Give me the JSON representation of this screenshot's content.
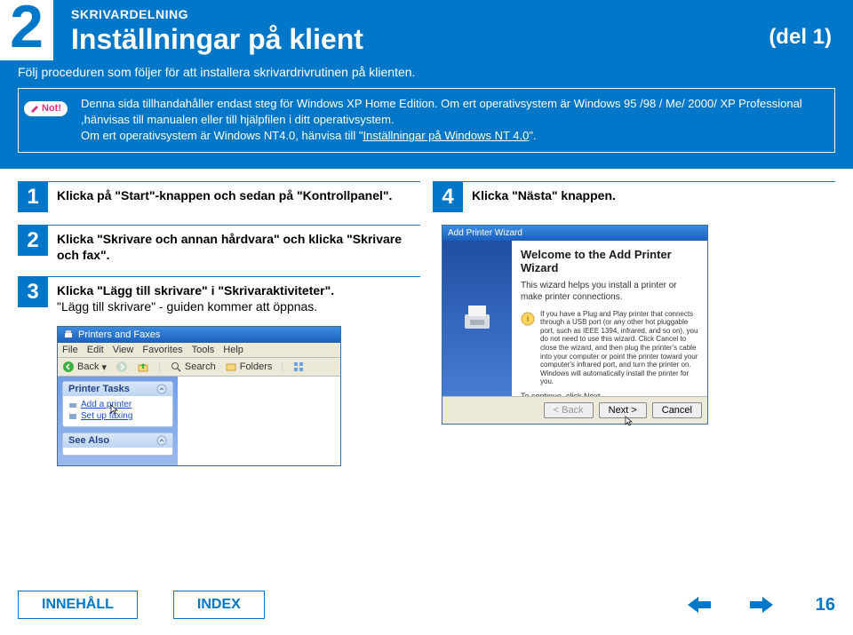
{
  "chapter_number": "2",
  "section_label": "SKRIVARDELNING",
  "page_title": "Inställningar på klient",
  "part_label": "(del 1)",
  "intro": "Följ proceduren som följer för att installera skrivardrivrutinen på klienten.",
  "note": {
    "badge": "Not!",
    "text1": "Denna sida tillhandahåller endast steg för Windows XP Home Edition. Om ert operativsystem är Windows 95 /98 / Me/ 2000/ XP Professional ,hänvisas till manualen eller till hjälpfilen i ditt operativsystem.",
    "text2_prefix": "Om ert operativsystem är Windows NT4.0, hänvisa till \"",
    "link_text": "Inställningar på Windows NT 4.0",
    "text2_suffix": "\"."
  },
  "steps": {
    "left": [
      {
        "num": "1",
        "text": "Klicka på \"Start\"-knappen och sedan på \"Kontrollpanel\"."
      },
      {
        "num": "2",
        "text": "Klicka \"Skrivare och annan hårdvara\" och klicka \"Skrivare och fax\"."
      },
      {
        "num": "3",
        "text": "Klicka \"Lägg till skrivare\" i \"Skrivaraktiviteter\".",
        "sub": "\"Lägg till skrivare\" - guiden kommer att öppnas."
      }
    ],
    "right": [
      {
        "num": "4",
        "text": "Klicka \"Nästa\" knappen."
      }
    ]
  },
  "pf_window": {
    "title": "Printers and Faxes",
    "menu": [
      "File",
      "Edit",
      "View",
      "Favorites",
      "Tools",
      "Help"
    ],
    "toolbar": {
      "back": "Back",
      "search": "Search",
      "folders": "Folders"
    },
    "task_panel_head": "Printer Tasks",
    "add_printer": "Add a printer",
    "setup_faxing": "Set up faxing",
    "see_also": "See Also"
  },
  "wizard": {
    "title": "Add Printer Wizard",
    "heading": "Welcome to the Add Printer Wizard",
    "line1": "This wizard helps you install a printer or make printer connections.",
    "info": "If you have a Plug and Play printer that connects through a USB port (or any other hot pluggable port, such as IEEE 1394, infrared, and so on), you do not need to use this wizard. Click Cancel to close the wizard, and then plug the printer's cable into your computer or point the printer toward your computer's infrared port, and turn the printer on. Windows will automatically install the printer for you.",
    "cont": "To continue, click Next.",
    "buttons": {
      "back": "< Back",
      "next": "Next >",
      "cancel": "Cancel"
    }
  },
  "footer": {
    "contents": "INNEHÅLL",
    "index": "INDEX",
    "page": "16"
  }
}
